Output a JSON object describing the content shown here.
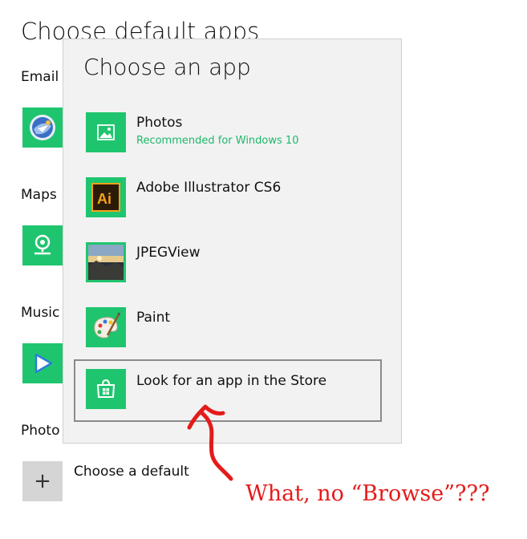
{
  "page": {
    "title": "Choose default apps",
    "sections": [
      {
        "label": "Email",
        "icon": "thunderbird-icon"
      },
      {
        "label": "Maps",
        "icon": "maps-icon"
      },
      {
        "label": "Music",
        "icon": "play-icon"
      },
      {
        "label": "Photo",
        "icon": ""
      }
    ],
    "choose_default_label": "Choose a default",
    "plus_symbol": "+"
  },
  "flyout": {
    "title": "Choose an app",
    "apps": [
      {
        "name": "Photos",
        "subtitle": "Recommended for Windows 10",
        "icon": "photos-icon",
        "color": "#1fc56e"
      },
      {
        "name": "Adobe Illustrator CS6",
        "subtitle": "",
        "icon": "illustrator-icon",
        "color": "#f7a21a"
      },
      {
        "name": "JPEGView",
        "subtitle": "",
        "icon": "jpegview-icon",
        "color": "#56606d"
      },
      {
        "name": "Paint",
        "subtitle": "",
        "icon": "paint-palette-icon",
        "color": "#1fc56e"
      }
    ],
    "store_link": "Look for an app in the Store"
  },
  "annotation": {
    "text": "What, no “Browse”???",
    "color": "#e41b1b"
  },
  "colors": {
    "accent_green": "#1fc56e",
    "flyout_bg": "#f2f2f2",
    "subtitle_green": "#1db86a"
  }
}
